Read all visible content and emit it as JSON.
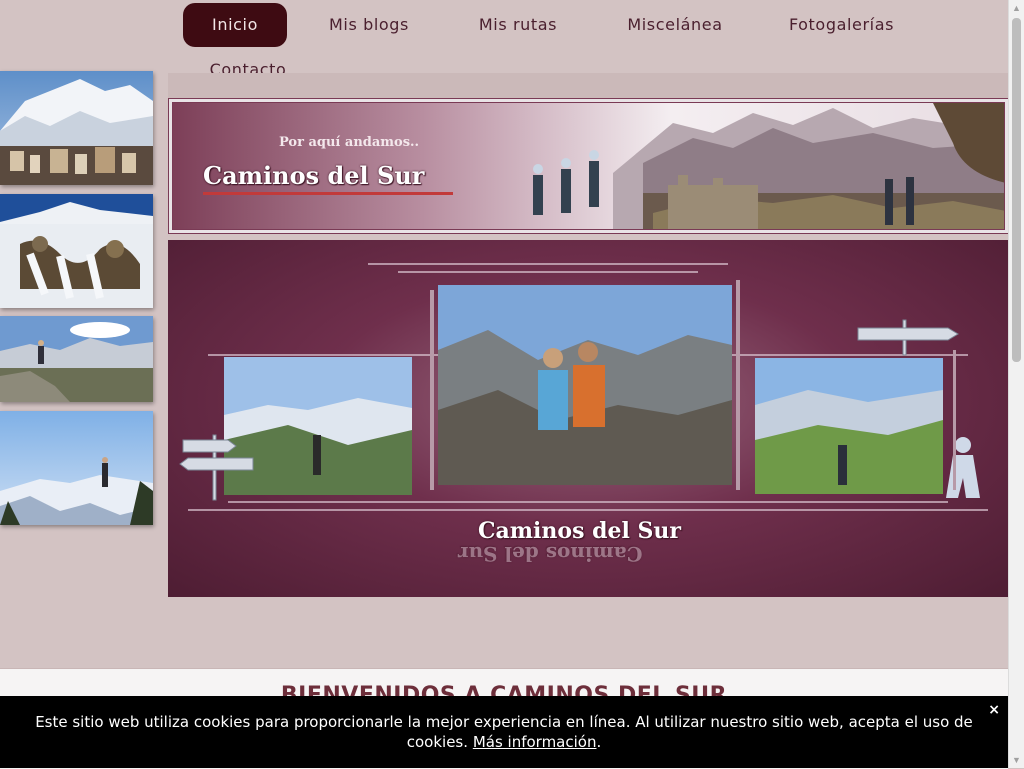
{
  "nav": {
    "items": [
      {
        "label": "Inicio",
        "active": true
      },
      {
        "label": "Mis blogs",
        "active": false
      },
      {
        "label": "Mis rutas",
        "active": false
      },
      {
        "label": "Miscelánea",
        "active": false
      },
      {
        "label": "Fotogalerías",
        "active": false
      },
      {
        "label": "Contacto",
        "active": false
      }
    ]
  },
  "banner": {
    "subtitle": "Por aquí andamos..",
    "logo": "Caminos del Sur"
  },
  "hero": {
    "logo": "Caminos del Sur"
  },
  "welcome": {
    "title": "BIENVENIDOS A CAMINOS DEL SUR"
  },
  "cookie": {
    "text": "Este sitio web utiliza cookies para proporcionarle la mejor experiencia en línea. Al utilizar nuestro sitio web, acepta el uso de cookies.",
    "link": "Más información",
    "trailing": ".",
    "close": "×"
  },
  "colors": {
    "active_nav": "#3e0b12",
    "page_bg": "#d3c3c3",
    "brand_wine": "#5a2239"
  }
}
